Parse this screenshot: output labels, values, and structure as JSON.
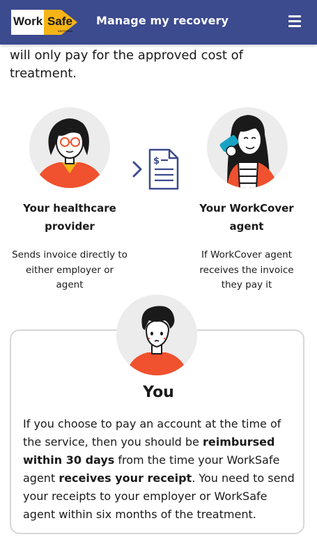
{
  "header": {
    "logo": {
      "work": "Work",
      "safe": "Safe",
      "subtext": "VICTORIA"
    },
    "title": "Manage my recovery",
    "menu_icon": "hamburger-menu-icon"
  },
  "intro_text": "will only pay for the approved cost of treatment.",
  "flow": {
    "arrow_icon": "chevron-right-icon",
    "document_icon": "invoice-document-icon",
    "provider": {
      "heading": "Your healthcare provider",
      "description": "Sends invoice directly to either employer or agent"
    },
    "agent": {
      "heading": "Your WorkCover agent",
      "description": "If WorkCover agent receives the invoice they pay it"
    }
  },
  "you": {
    "title": "You",
    "text_1": "If you choose to pay an account at the time of the service, then you should be ",
    "bold_1": "reimbursed within 30 days",
    "text_2": " from the time your WorkSafe agent ",
    "bold_2": "receives your receipt",
    "text_3": ". You need to send your receipts to your employer or WorkSafe agent within six months of the treatment."
  },
  "colors": {
    "header_bg": "#3c4a8e",
    "logo_yellow": "#f6b417",
    "accent_red": "#f0512e",
    "avatar_bg": "#ececec"
  }
}
